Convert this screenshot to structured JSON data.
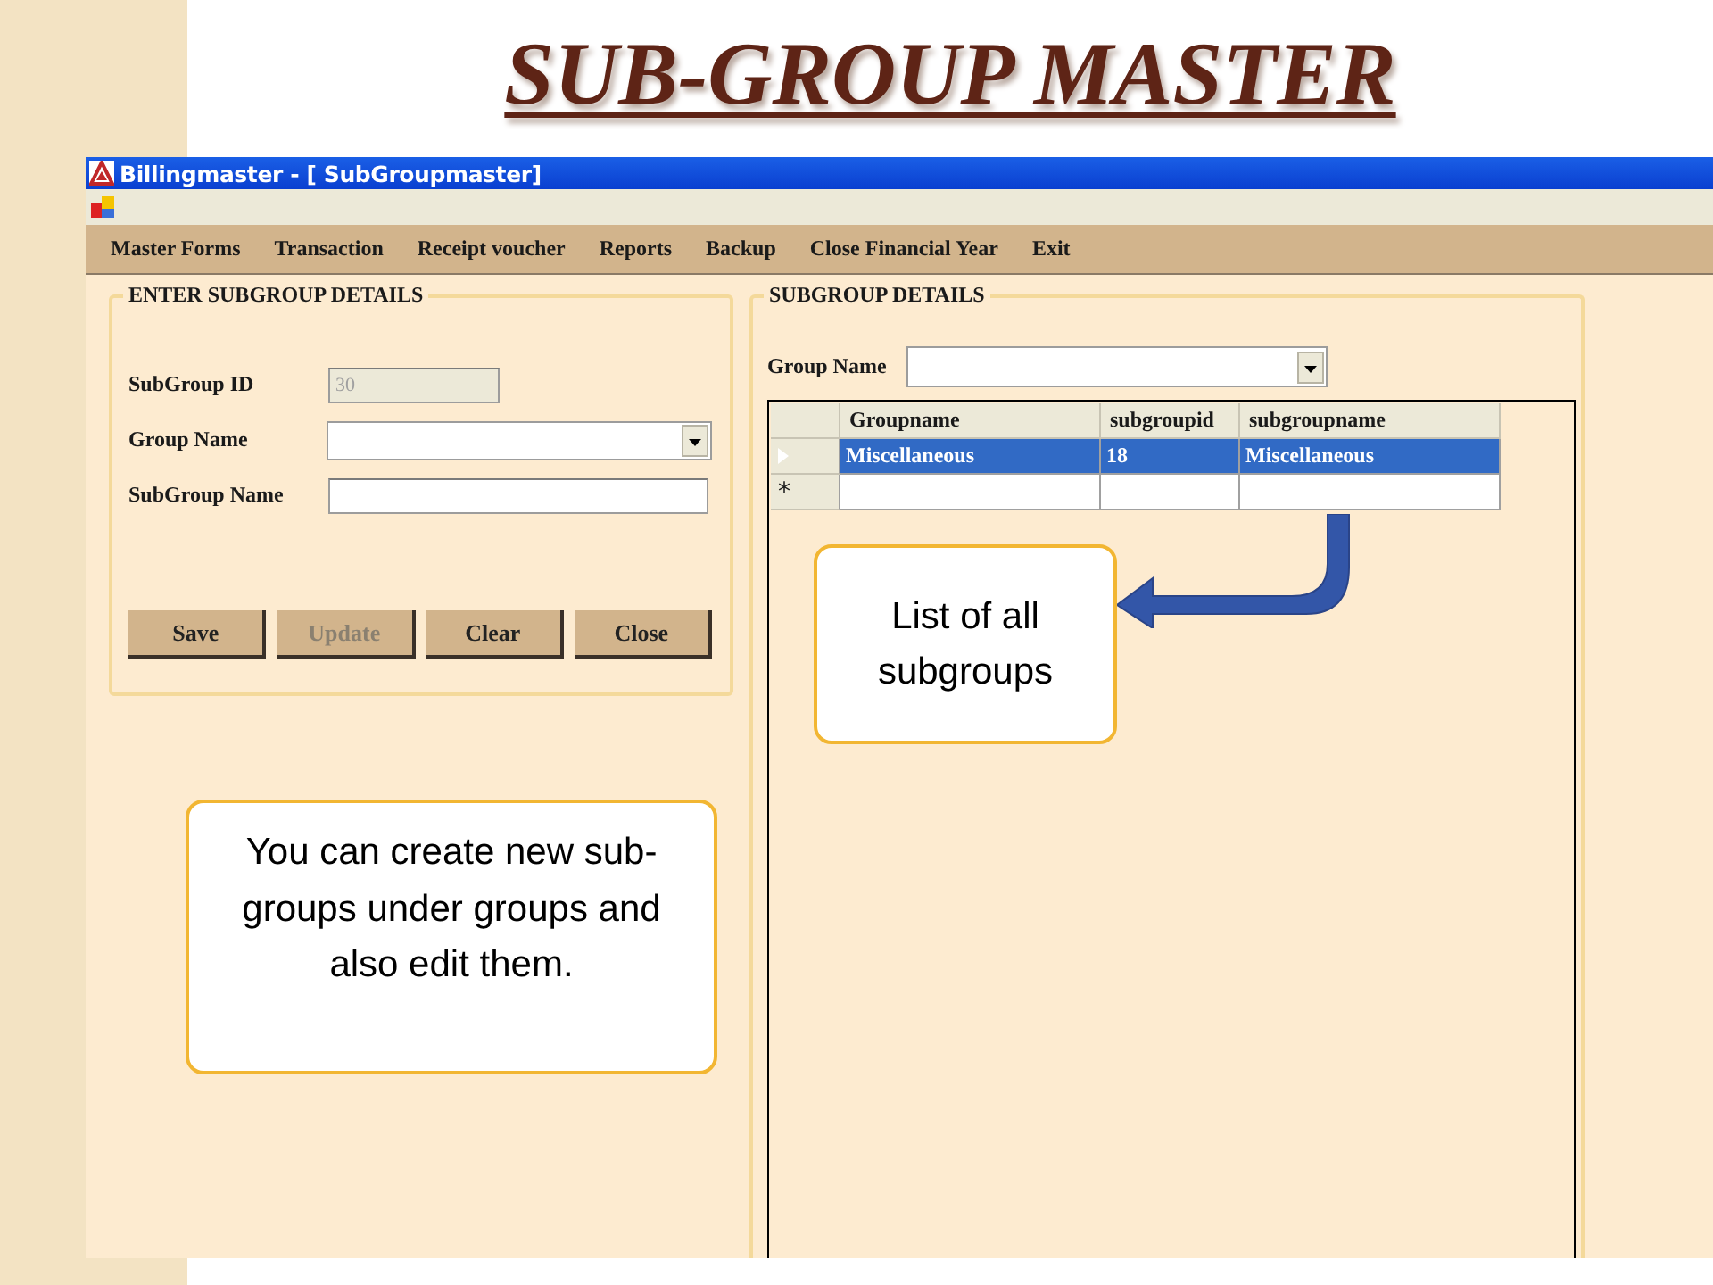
{
  "slide_title": "SUB-GROUP MASTER",
  "window": {
    "title": "Billingmaster - [ SubGroupmaster]"
  },
  "menu": [
    "Master Forms",
    "Transaction",
    "Receipt voucher",
    "Reports",
    "Backup",
    "Close Financial Year",
    "Exit"
  ],
  "form": {
    "legend": "ENTER SUBGROUP DETAILS",
    "fields": [
      {
        "label": "SubGroup ID",
        "kind": "text",
        "value": "30",
        "disabled": true
      },
      {
        "label": "Group Name",
        "kind": "dropdown",
        "disabled": false
      },
      {
        "label": "SubGroup Name",
        "kind": "text",
        "disabled": false
      }
    ],
    "buttons": [
      {
        "label": "Save",
        "disabled": false
      },
      {
        "label": "Update",
        "disabled": true
      },
      {
        "label": "Clear",
        "disabled": false
      },
      {
        "label": "Close",
        "disabled": false
      }
    ]
  },
  "details": {
    "legend": "SUBGROUP DETAILS",
    "filter_label": "Group Name",
    "grid": {
      "columns": [
        "Groupname",
        "subgroupid",
        "subgroupname"
      ],
      "rows": [
        {
          "kind": "data",
          "selected": true,
          "cells": [
            "Miscellaneous",
            "18",
            "Miscellaneous"
          ]
        },
        {
          "kind": "new",
          "selected": false,
          "marker": "*"
        }
      ]
    }
  },
  "callouts": [
    {
      "text": "List of all subgroups"
    },
    {
      "text": "You can create new sub-groups  under  groups and  also edit them."
    }
  ]
}
